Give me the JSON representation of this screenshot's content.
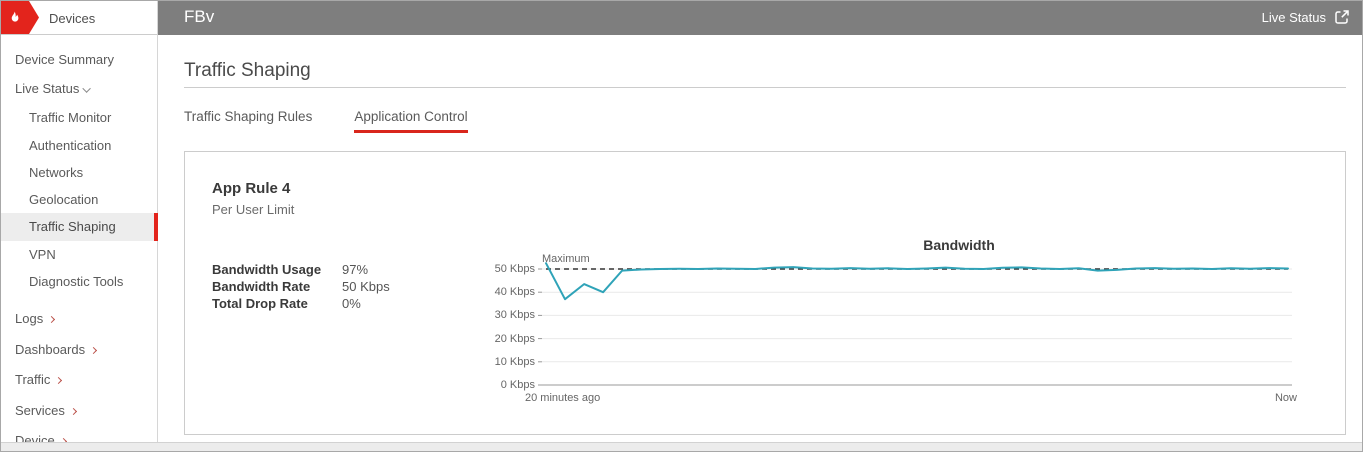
{
  "sidebar": {
    "header": {
      "label": "Devices"
    },
    "items": [
      {
        "label": "Device Summary"
      },
      {
        "label": "Live Status"
      },
      {
        "label": "Traffic Monitor"
      },
      {
        "label": "Authentication"
      },
      {
        "label": "Networks"
      },
      {
        "label": "Geolocation"
      },
      {
        "label": "Traffic Shaping"
      },
      {
        "label": "VPN"
      },
      {
        "label": "Diagnostic Tools"
      },
      {
        "label": "Logs"
      },
      {
        "label": "Dashboards"
      },
      {
        "label": "Traffic"
      },
      {
        "label": "Services"
      },
      {
        "label": "Device"
      }
    ]
  },
  "header": {
    "title": "FBv",
    "live_status_label": "Live Status"
  },
  "page": {
    "title": "Traffic Shaping"
  },
  "tabs": [
    {
      "label": "Traffic Shaping Rules",
      "active": false
    },
    {
      "label": "Application Control",
      "active": true
    }
  ],
  "card": {
    "rule_name": "App Rule 4",
    "rule_subtitle": "Per User Limit",
    "stats": [
      {
        "label": "Bandwidth Usage",
        "value": "97%"
      },
      {
        "label": "Bandwidth Rate",
        "value": "50 Kbps"
      },
      {
        "label": "Total Drop Rate",
        "value": "0%"
      }
    ]
  },
  "chart_data": {
    "type": "line",
    "title": "Bandwidth",
    "xlabel": "",
    "ylabel": "Kbps",
    "ylim": [
      0,
      55
    ],
    "grid": true,
    "x_start_label": "20 minutes ago",
    "x_end_label": "Now",
    "yticks": [
      "0 Kbps",
      "10 Kbps",
      "20 Kbps",
      "30 Kbps",
      "40 Kbps",
      "50 Kbps"
    ],
    "max_line": {
      "label": "Maximum",
      "value": 50,
      "style": "dashed",
      "color": "#333333"
    },
    "series": [
      {
        "name": "Bandwidth",
        "color": "#2fa3b8",
        "unit": "Kbps",
        "x_span_minutes": 20,
        "values": [
          52.5,
          37,
          43.5,
          40,
          49.3,
          49.8,
          50,
          50.1,
          50,
          50.2,
          50.1,
          50,
          50.6,
          50.8,
          50.2,
          50.1,
          50.4,
          50.1,
          50.3,
          50,
          50.2,
          50.6,
          50.1,
          50,
          50.5,
          50.7,
          50.2,
          50,
          50.3,
          49.3,
          49.6,
          50.2,
          50.4,
          50.1,
          50.2,
          50,
          50.3,
          50.1,
          50.4,
          50.2
        ]
      }
    ]
  },
  "colors": {
    "accent_red": "#e3241c",
    "topbar_gray": "#7e7e7e",
    "line_teal": "#2fa3b8",
    "selected_item_bg": "#ededed"
  }
}
